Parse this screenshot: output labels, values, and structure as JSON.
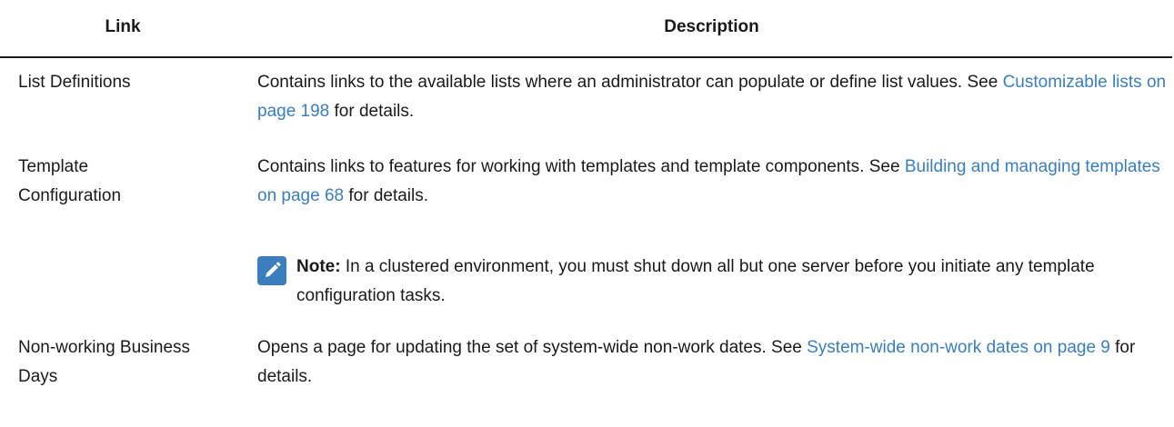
{
  "header": {
    "col_link": "Link",
    "col_description": "Description"
  },
  "rows": [
    {
      "link": "List Definitions",
      "desc_before": "Contains links to the available lists where an administrator can populate or define list values. See ",
      "desc_link": "Customizable lists on page 198",
      "desc_after": " for details."
    },
    {
      "link_line1": "Template",
      "link_line2": "Configuration",
      "desc_before": "Contains links to features for working with templates and template components. See ",
      "desc_link": "Building and managing templates on page 68",
      "desc_after": " for details.",
      "note_label": "Note:",
      "note_text": " In a clustered environment, you must shut down all but one server before you initiate any template configuration tasks."
    },
    {
      "link_line1": "Non-working Business",
      "link_line2": "Days",
      "desc_before": "Opens a page for updating the set of system-wide non-work dates. See ",
      "desc_link": "System-wide non-work dates on page 9",
      "desc_after": " for details."
    }
  ],
  "colors": {
    "link": "#3a7ebd",
    "text": "#1a1a1a"
  },
  "icons": {
    "note": "pencil-icon"
  }
}
